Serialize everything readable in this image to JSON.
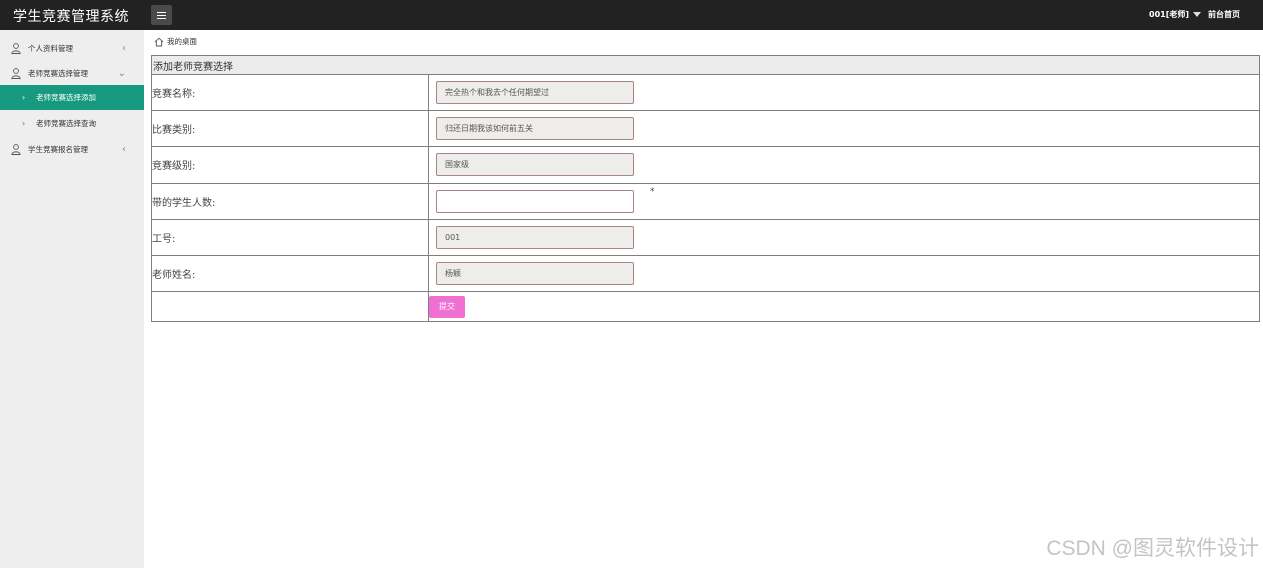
{
  "header": {
    "app_title": "学生竞赛管理系统",
    "menu_toggle_icon": "hamburger-icon",
    "user_label": "001[老师]",
    "front_link": "前台首页"
  },
  "sidebar": {
    "items": [
      {
        "label": "个人资料管理",
        "icon": "user-icon",
        "arrow": "‹"
      },
      {
        "label": "老师竞赛选择管理",
        "icon": "user-icon",
        "arrow": "⌄"
      },
      {
        "label": "学生竞赛报名管理",
        "icon": "user-icon",
        "arrow": "‹"
      }
    ],
    "sub_items": [
      {
        "label": "老师竞赛选择添加",
        "active": true
      },
      {
        "label": "老师竞赛选择查询",
        "active": false
      }
    ],
    "active_color": "#16997f"
  },
  "breadcrumb": {
    "label": "我的桌面",
    "icon": "home-icon"
  },
  "form": {
    "title": "添加老师竞赛选择",
    "fields": [
      {
        "label": "竞赛名称:",
        "value": "完全热个和我去个任何期望过"
      },
      {
        "label": "比赛类别:",
        "value": "归还日期我该如何前五关"
      },
      {
        "label": "竞赛级别:",
        "value": "国家级"
      },
      {
        "label": "带的学生人数:",
        "value": "",
        "required_mark": "*"
      },
      {
        "label": "工号:",
        "value": "001"
      },
      {
        "label": "老师姓名:",
        "value": "杨颖"
      }
    ],
    "submit_label": "提交",
    "submit_color": "#f06fd2"
  },
  "watermark": "CSDN @图灵软件设计"
}
